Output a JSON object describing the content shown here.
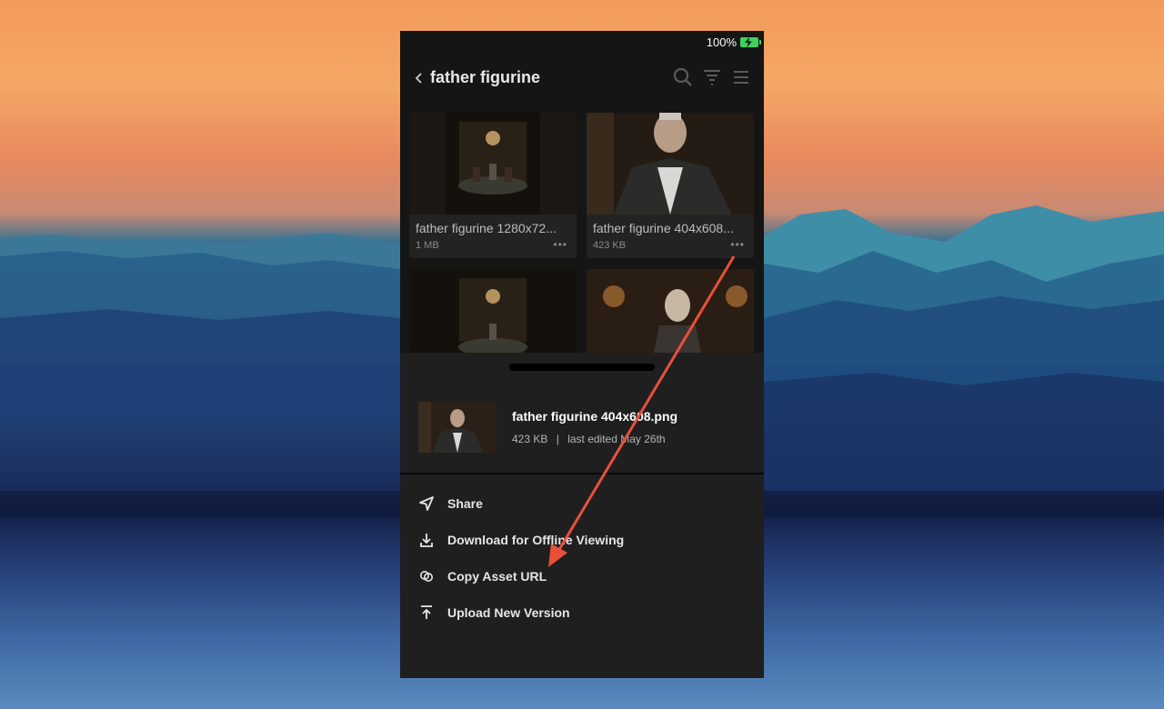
{
  "status_bar": {
    "battery_text": "100%"
  },
  "header": {
    "back_icon": "chevron-left-icon",
    "title": "father figurine"
  },
  "grid": [
    {
      "name": "father figurine 1280x72...",
      "size": "1 MB"
    },
    {
      "name": "father figurine 404x608...",
      "size": "423 KB"
    },
    {
      "name": "",
      "size": ""
    },
    {
      "name": "",
      "size": ""
    }
  ],
  "sheet": {
    "asset_name": "father figurine 404x608.png",
    "asset_size": "423 KB",
    "asset_separator": "|",
    "asset_edited": "last edited May 26th",
    "menu": [
      {
        "icon": "share-icon",
        "label": "Share"
      },
      {
        "icon": "download-icon",
        "label": "Download for Offline Viewing"
      },
      {
        "icon": "link-icon",
        "label": "Copy Asset URL"
      },
      {
        "icon": "upload-icon",
        "label": "Upload New Version"
      }
    ]
  },
  "colors": {
    "annotation_arrow": "#e8503a",
    "battery": "#3fd15b",
    "sheet_bg": "#1f1f1f",
    "app_bg": "#151515"
  }
}
